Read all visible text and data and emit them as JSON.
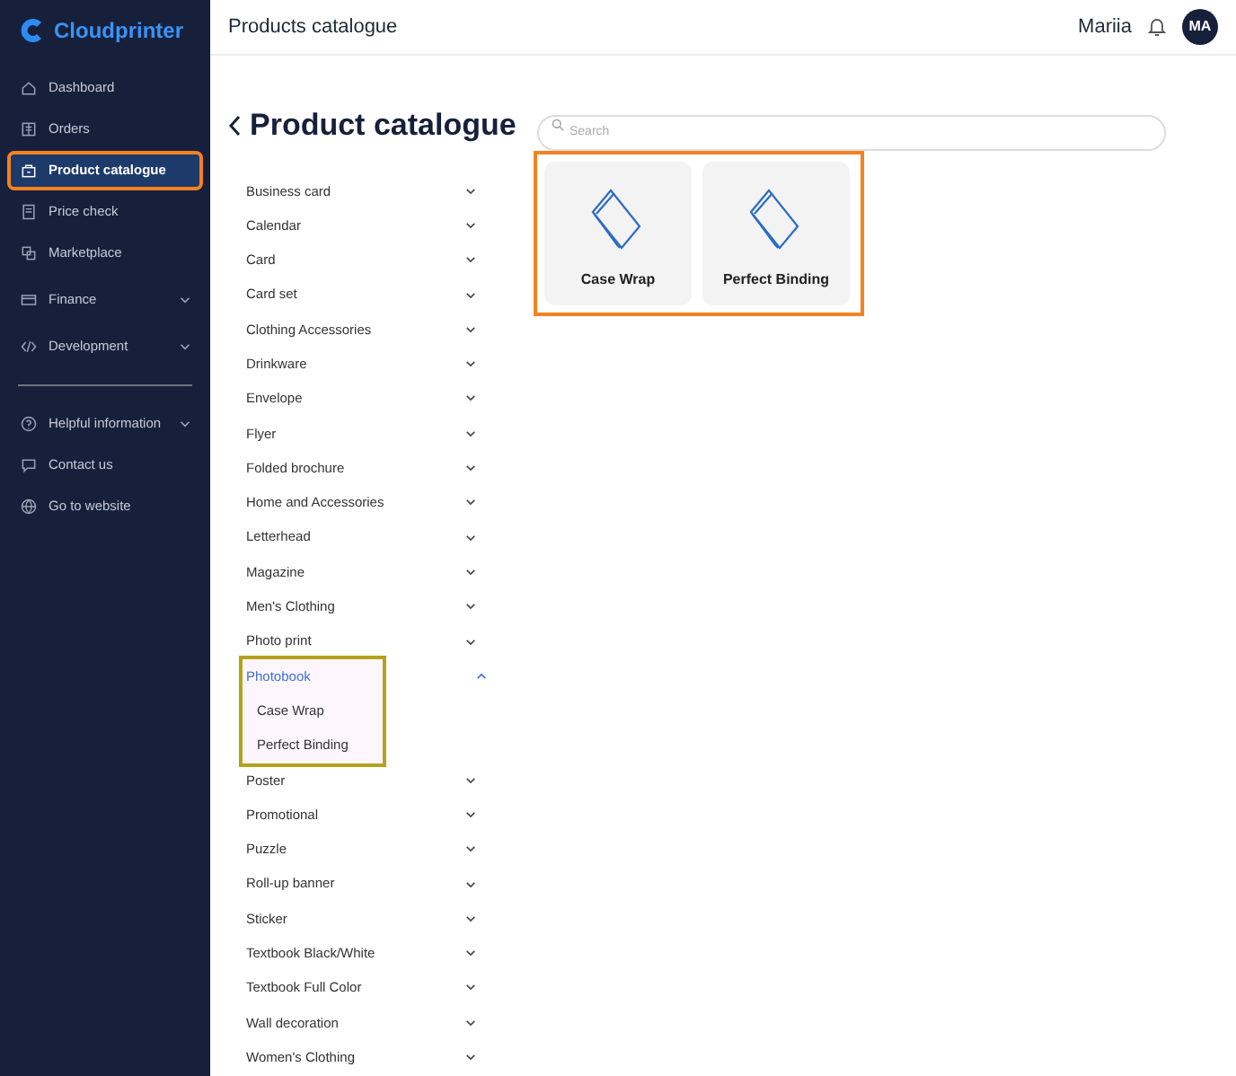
{
  "sidebar": {
    "logo": "Cloudprinter",
    "items": [
      {
        "label": "Dashboard",
        "selected": false,
        "highlighted": false,
        "expandable": false
      },
      {
        "label": "Orders",
        "selected": false,
        "highlighted": false,
        "expandable": false
      },
      {
        "label": "Product catalogue",
        "selected": true,
        "highlighted": true,
        "expandable": false
      },
      {
        "label": "Price check",
        "selected": false,
        "highlighted": false,
        "expandable": false
      },
      {
        "label": "Marketplace",
        "selected": false,
        "highlighted": false,
        "expandable": false
      },
      {
        "label": "Finance",
        "selected": false,
        "highlighted": false,
        "expandable": true
      },
      {
        "label": "Development",
        "selected": false,
        "highlighted": false,
        "expandable": true
      }
    ],
    "bottom_items": [
      {
        "label": "Helpful information",
        "expandable": true
      },
      {
        "label": "Contact us",
        "expandable": false
      },
      {
        "label": "Go to website",
        "expandable": false
      }
    ]
  },
  "header": {
    "title": "Products catalogue",
    "user": "Mariia",
    "avatar": "MA"
  },
  "page_title": "Product catalogue",
  "search": {
    "placeholder": "Search"
  },
  "categories": [
    {
      "label": "Business card",
      "expanded": false
    },
    {
      "label": "Calendar",
      "expanded": false
    },
    {
      "label": "Card",
      "expanded": false
    },
    {
      "label": "Card set",
      "expanded": false
    },
    {
      "label": "Clothing Accessories",
      "expanded": false
    },
    {
      "label": "Drinkware",
      "expanded": false
    },
    {
      "label": "Envelope",
      "expanded": false
    },
    {
      "label": "Flyer",
      "expanded": false
    },
    {
      "label": "Folded brochure",
      "expanded": false
    },
    {
      "label": "Home and Accessories",
      "expanded": false
    },
    {
      "label": "Letterhead",
      "expanded": false
    },
    {
      "label": "Magazine",
      "expanded": false
    },
    {
      "label": "Men's Clothing",
      "expanded": false
    },
    {
      "label": "Photo print",
      "expanded": false
    },
    {
      "label": "Photobook",
      "expanded": true,
      "highlighted": true,
      "children": [
        {
          "label": "Case Wrap"
        },
        {
          "label": "Perfect Binding"
        }
      ]
    },
    {
      "label": "Poster",
      "expanded": false
    },
    {
      "label": "Promotional",
      "expanded": false
    },
    {
      "label": "Puzzle",
      "expanded": false
    },
    {
      "label": "Roll-up banner",
      "expanded": false
    },
    {
      "label": "Sticker",
      "expanded": false
    },
    {
      "label": "Textbook Black/White",
      "expanded": false
    },
    {
      "label": "Textbook Full Color",
      "expanded": false
    },
    {
      "label": "Wall decoration",
      "expanded": false
    },
    {
      "label": "Women's Clothing",
      "expanded": false
    }
  ],
  "products": {
    "highlighted": true,
    "items": [
      {
        "label": "Case Wrap"
      },
      {
        "label": "Perfect Binding"
      }
    ]
  }
}
